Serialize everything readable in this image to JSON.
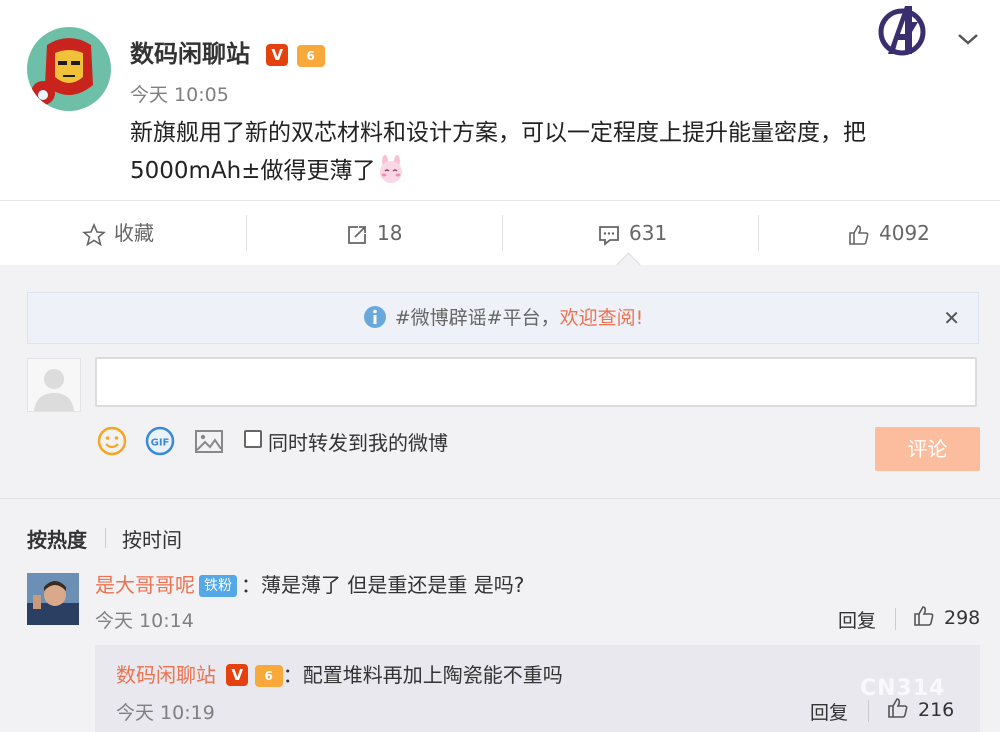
{
  "post": {
    "author": "数码闲聊站",
    "verified_badge": "V",
    "level_badge": "6",
    "time": "今天 10:05",
    "text_line1": "新旗舰用了新的双芯材料和设计方案，可以一定程度上提升能量密度，把",
    "text_line2": "5000mAh±做得更薄了",
    "emoji_icon": "bunny-emoji-icon"
  },
  "actions": {
    "favorite_label": "收藏",
    "repost_count": "18",
    "comment_count": "631",
    "like_count": "4092"
  },
  "notice": {
    "tag": "#微博辟谣#平台，",
    "link": "欢迎查阅!",
    "close": "✕"
  },
  "composer": {
    "repost_label": "同时转发到我的微博",
    "submit_label": "评论",
    "gif_label": "GIF"
  },
  "sort": {
    "hot": "按热度",
    "time": "按时间"
  },
  "comments": [
    {
      "user": "是大哥哥呢",
      "badge": "铁粉",
      "text": "：薄是薄了 但是重还是重 是吗?",
      "time": "今天 10:14",
      "reply_label": "回复",
      "likes": "298"
    }
  ],
  "reply": {
    "user": "数码闲聊站",
    "verified_badge": "V",
    "level_badge": "6",
    "text": "：配置堆料再加上陶瓷能不重吗",
    "time": "今天 10:19",
    "reply_label": "回复",
    "likes": "216"
  },
  "watermark": "CN314",
  "colors": {
    "username": "#eb7350",
    "submit_disabled": "#fbbd9d",
    "notice_link": "#eb7350",
    "badge_blue": "#55a8e8"
  }
}
